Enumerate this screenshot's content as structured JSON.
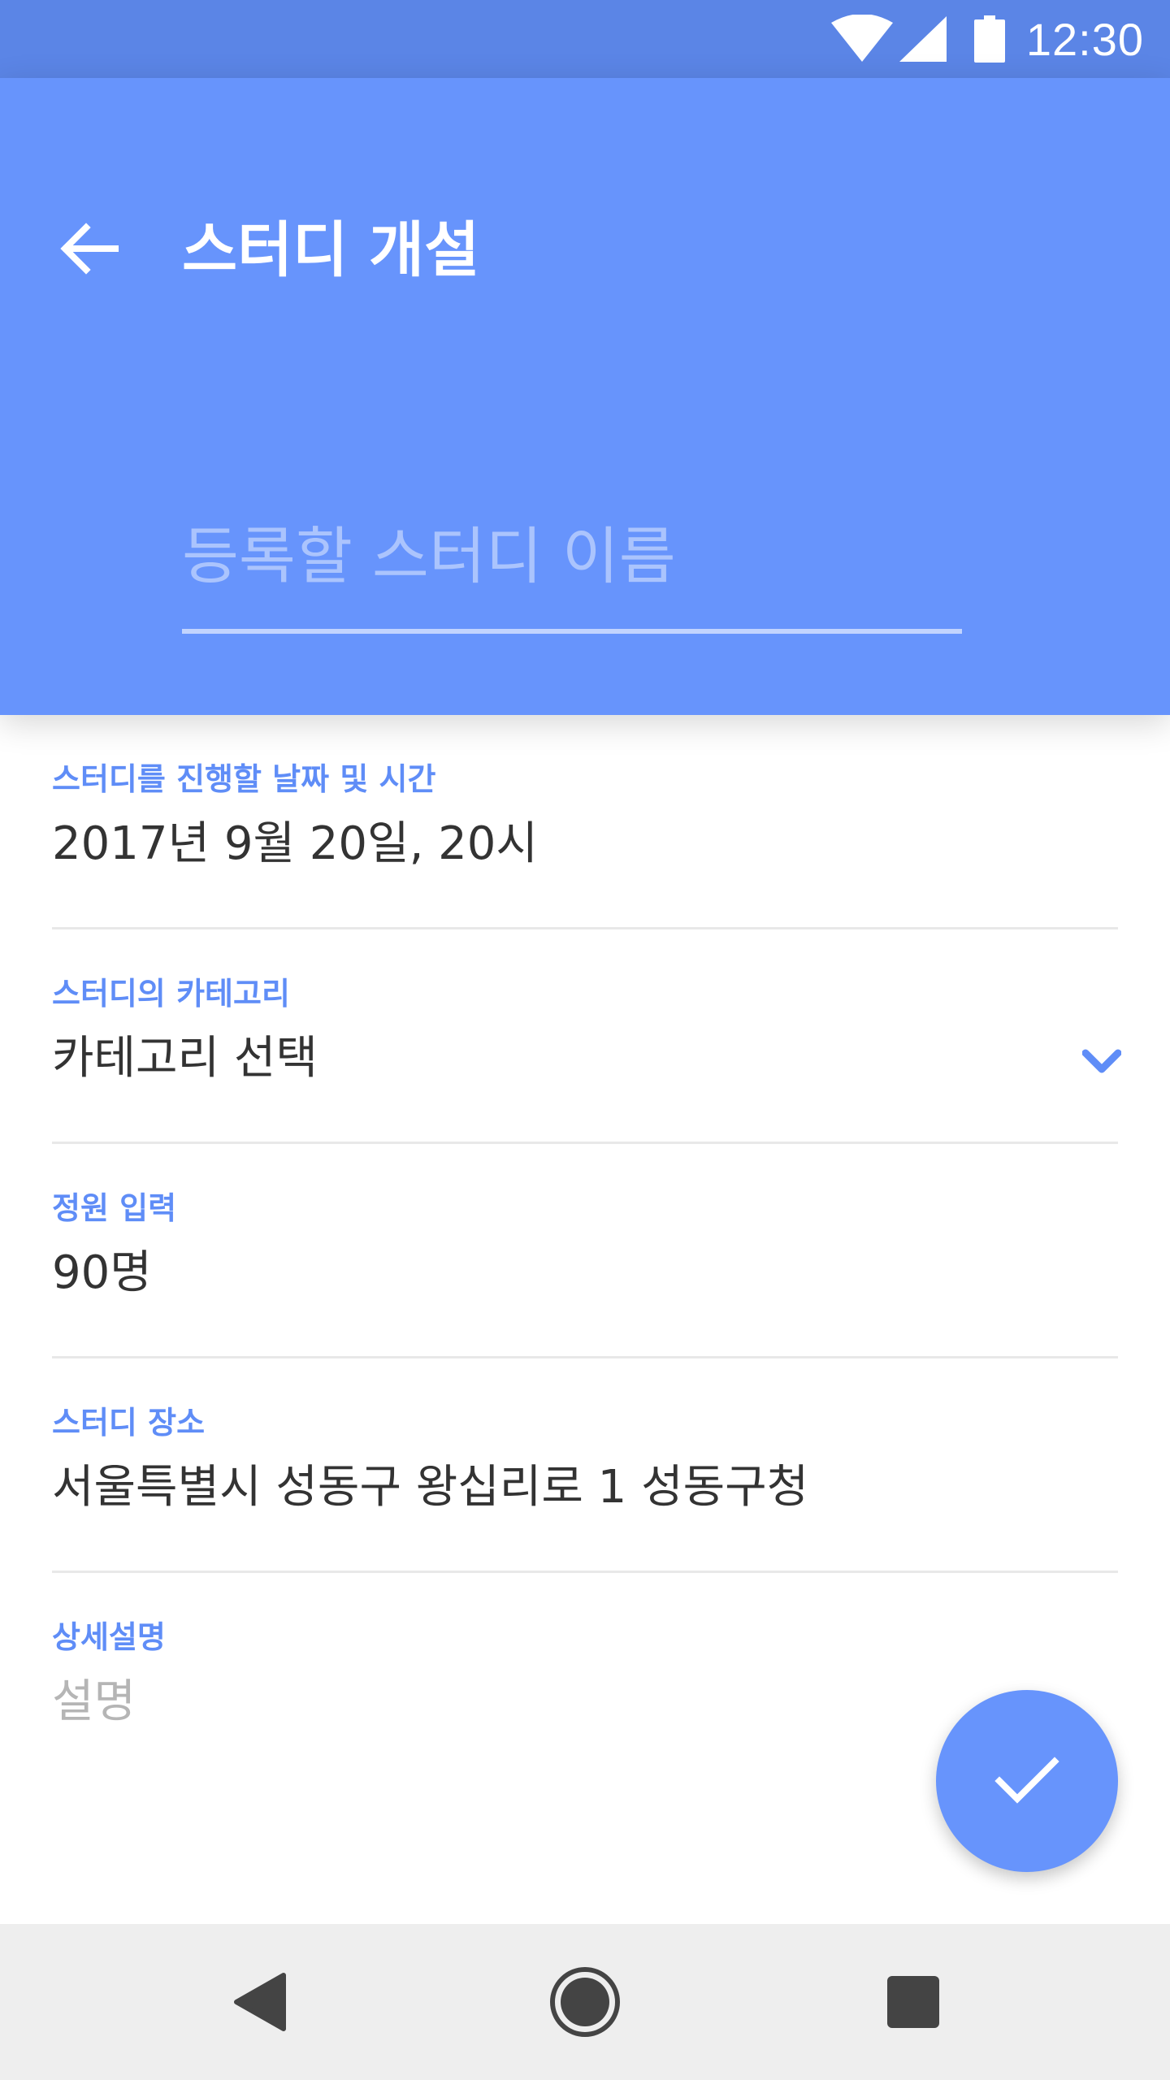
{
  "status_bar": {
    "time": "12:30",
    "icons": [
      "wifi-icon",
      "cellular-signal-icon",
      "battery-icon"
    ]
  },
  "header": {
    "back_icon": "arrow-back-icon",
    "title": "스터디 개설",
    "name_placeholder": "등록할 스터디 이름"
  },
  "fields": {
    "datetime": {
      "label": "스터디를 진행할 날짜 및 시간",
      "value": "2017년 9월 20일, 20시"
    },
    "category": {
      "label": "스터디의 카테고리",
      "value": "카테고리 선택",
      "icon": "chevron-down-icon"
    },
    "capacity": {
      "label": "정원 입력",
      "value": "90명"
    },
    "location": {
      "label": "스터디 장소",
      "value": "서울특별시 성동구 왕십리로 1 성동구청"
    },
    "description": {
      "label": "상세설명",
      "placeholder": "설명"
    }
  },
  "fab": {
    "icon": "check-icon"
  },
  "nav_bar": {
    "icons": [
      "nav-back-icon",
      "nav-home-icon",
      "nav-recents-icon"
    ]
  },
  "colors": {
    "status_bar": "#5b85e6",
    "primary": "#6794fc",
    "accent_label": "#5f8df7",
    "text": "#333333",
    "placeholder": "#b5b5b5",
    "nav_bar": "#eeeeee"
  }
}
